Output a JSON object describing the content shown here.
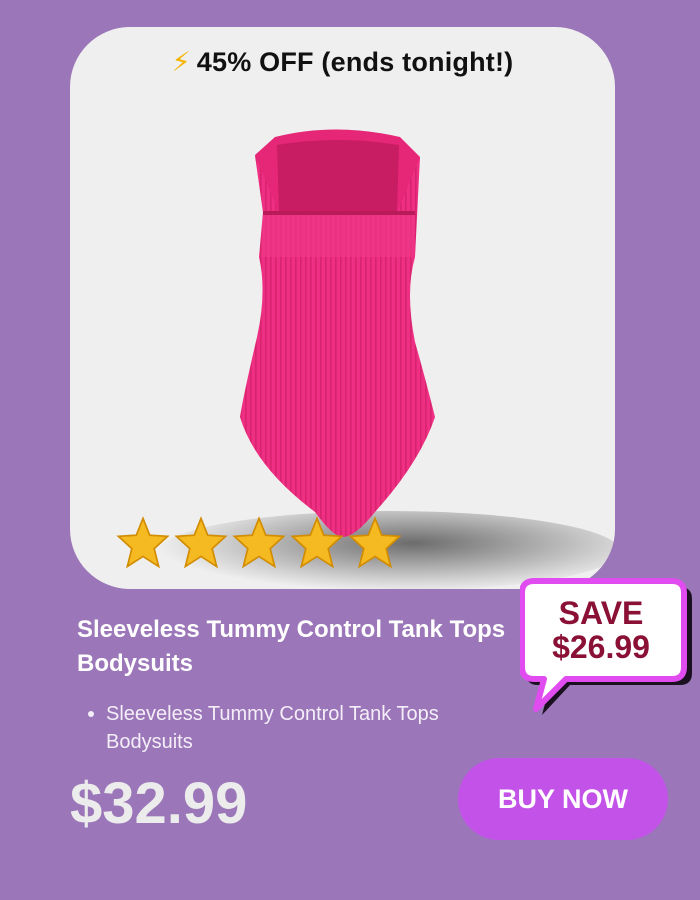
{
  "promo": {
    "icon": "lightning-bolt-icon",
    "text": "⚡",
    "label": "45% OFF (ends tonight!)"
  },
  "product": {
    "image": "pink-bodysuit-image",
    "rating_stars": 5,
    "title": "Sleeveless Tummy Control Tank Tops Bodysuits",
    "bullets": [
      "Sleeveless Tummy Control Tank Tops Bodysuits"
    ],
    "price": "$32.99"
  },
  "badge": {
    "line1": "SAVE",
    "line2": "$26.99"
  },
  "cta": {
    "label": "BUY NOW"
  },
  "colors": {
    "background": "#9b77b9",
    "card": "#f0efef",
    "product_pink": "#ef2f83",
    "button": "#c353e8",
    "badge_border": "#e04cf0",
    "badge_text": "#8a1036",
    "star": "#f5b921"
  }
}
